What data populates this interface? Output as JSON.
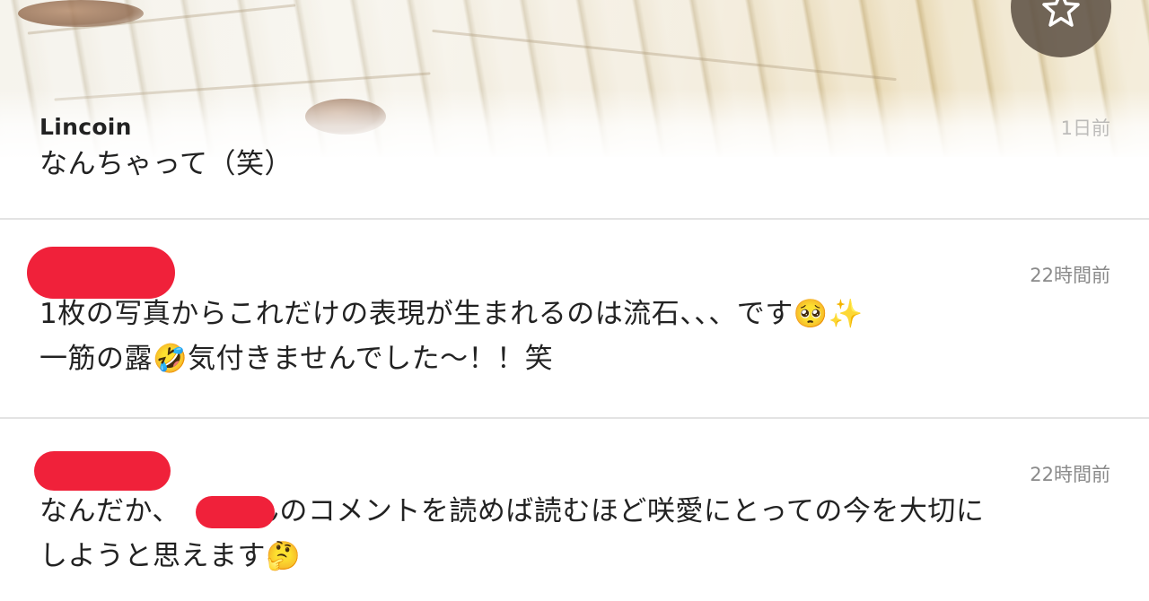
{
  "comments": [
    {
      "author": "Lincoin",
      "time": "1日前",
      "body_lines": [
        "なんちゃって（笑）"
      ]
    },
    {
      "author": "",
      "time": "22時間前",
      "body_lines": [
        "1枚の写真からこれだけの表現が生まれるのは流石、、、です🥺✨",
        "一筋の露🤣気付きませんでした〜！！笑"
      ]
    },
    {
      "author": "",
      "time": "22時間前",
      "body_lines": [
        "なんだか、　　さんのコメントを読めば読むほど咲愛にとっての今を大切に",
        "しようと思えます🤔"
      ]
    }
  ],
  "colors": {
    "redaction": "#f0213a",
    "divider": "#e3e3e3",
    "star_button_bg": "#5f5246",
    "text": "#222222",
    "timestamp": "#8a8a8a"
  },
  "icons": {
    "favorite": "star-icon"
  }
}
